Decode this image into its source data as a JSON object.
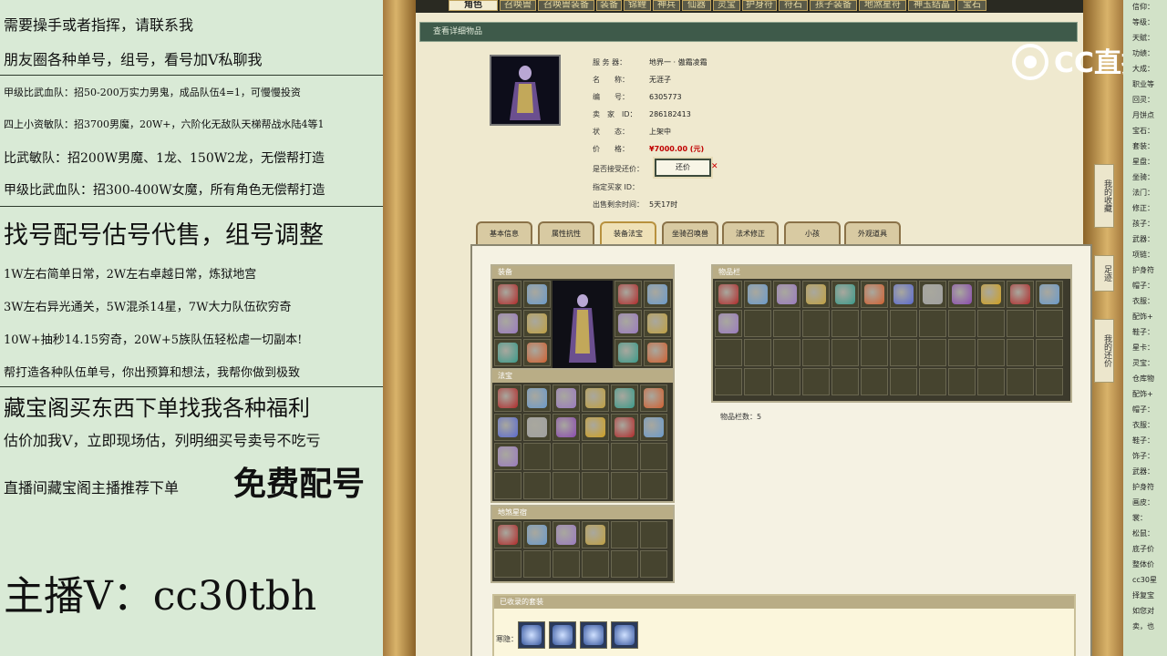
{
  "left_panel": {
    "lines": [
      {
        "text": "需要操手或者指挥，请联系我",
        "size": 16
      },
      {
        "text": "朋友圈各种单号，组号，看号加V私聊我",
        "size": 16
      },
      {
        "text": "甲级比武血队：招50-200万实力男鬼，成品队伍4=1，可慢慢投资",
        "size": 11
      },
      {
        "text": "四上小资敏队：招3700男魔，20W+，六阶化无敌队天梯帮战水陆4等1",
        "size": 11
      },
      {
        "text": "比武敏队：招200W男魔、1龙、150W2龙，无偿帮打造",
        "size": 14
      },
      {
        "text": "甲级比武血队：招300-400W女魔，所有角色无偿帮打造",
        "size": 14
      },
      {
        "text": "找号配号估号代售，组号调整",
        "size": 27
      },
      {
        "text": "1W左右简单日常，2W左右卓越日常，炼狱地宫",
        "size": 13
      },
      {
        "text": "3W左右异光通关，5W混杀14星，7W大力队伍砍穷奇",
        "size": 13
      },
      {
        "text": "10W+抽秒14.15穷奇，20W+5族队伍轻松虐一切副本!",
        "size": 13
      },
      {
        "text": "帮打造各种队伍单号，你出预算和想法，我帮你做到极致",
        "size": 13
      },
      {
        "text": "藏宝阁买东西下单找我各种福利",
        "size": 24
      },
      {
        "text": "估价加我V，立即现场估，列明细买号卖号不吃亏",
        "size": 16
      },
      {
        "text": "直播间藏宝阁主播推荐下单",
        "size": 16
      },
      {
        "text": "免费配号",
        "size": 36
      },
      {
        "text": "主播V：cc30tbh",
        "size": 44
      }
    ]
  },
  "game": {
    "top_nav": [
      "角色",
      "召唤兽",
      "召唤兽装备",
      "装备",
      "锦鲤",
      "神兵",
      "仙器",
      "灵宝",
      "护身符",
      "符石",
      "孩子装备",
      "地煞星符",
      "神玉结晶",
      "宝石"
    ],
    "header_title": "查看详细物品",
    "watermark_logo": "CC直播",
    "info": {
      "server_label": "服 务 器：",
      "server_value": "地界一 · 傲霜凌霜",
      "name_label": "名　　称：",
      "name_value": "无涯子",
      "id_label": "编　　号：",
      "id_value": "6305773",
      "seller_label": "卖　家　ID：",
      "seller_value": "286182413",
      "status_label": "状　　态：",
      "status_value": "上架中",
      "price_label": "价　　格：",
      "price_value": "¥7000.00 (元)",
      "bargain_label": "是否接受还价：",
      "bargain_button": "还价",
      "buyer_label": "指定买家 ID：",
      "buyer_value": "",
      "remaining_label": "出售剩余时间：",
      "remaining_value": "5天17时"
    },
    "sub_tabs": [
      "基本信息",
      "属性抗性",
      "装备法宝",
      "坐骑召唤兽",
      "法术修正",
      "小孩",
      "外观道具"
    ],
    "sections": {
      "equip_title": "装备",
      "fabao_title": "法宝",
      "earth_title": "地煞星宿",
      "items_title": "物品栏",
      "items_count_label": "物品栏数：5",
      "collected_title": "已收录的套装",
      "collected_label": "寒隐："
    }
  },
  "side_tabs": [
    "我的收藏",
    "足迹",
    "我的还价"
  ],
  "right_panel": {
    "lines": [
      "信仰：",
      "等级：",
      "天赋：",
      "功绩：",
      "大成：",
      "职业等",
      "回灵：",
      "月饼点",
      "宝石：",
      "套装：",
      "星盘：",
      "坐骑：",
      "法门：",
      "修正：",
      "孩子：",
      "武器：",
      "项链：",
      "护身符",
      "帽子：",
      "衣服：",
      "配饰+",
      "鞋子：",
      "星卡：",
      "灵宝：",
      "仓库物",
      "配饰+",
      "帽子：",
      "衣服：",
      "鞋子：",
      "饰子：",
      "武器：",
      "护身符",
      "画皮：",
      "裳：",
      "松鼠：",
      "底子价",
      "整体价",
      "cc30星",
      "择复宝",
      "如您对",
      "卖，也"
    ]
  }
}
